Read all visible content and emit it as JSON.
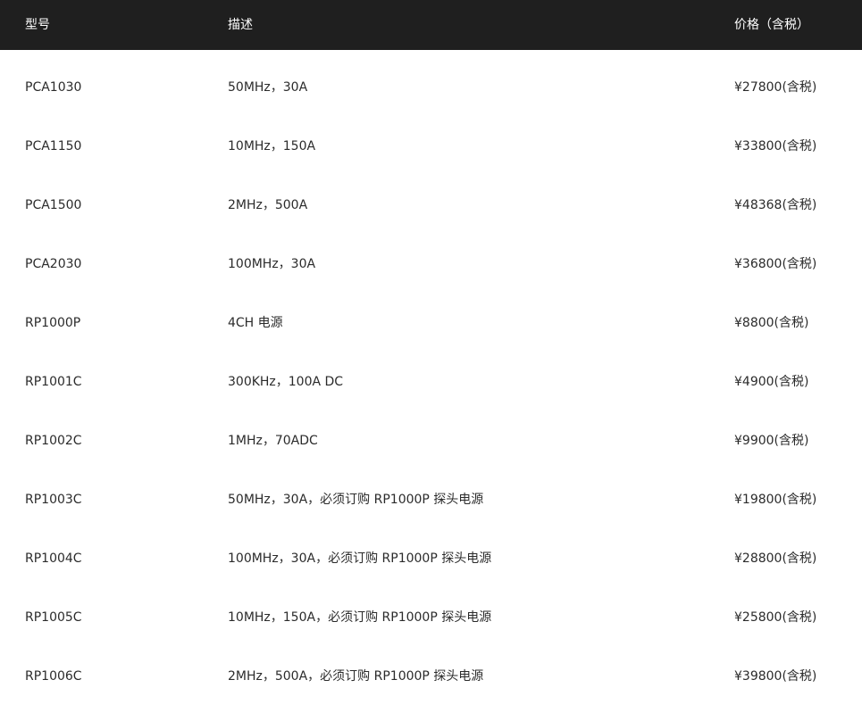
{
  "header": {
    "model": "型号",
    "description": "描述",
    "price": "价格（含税）"
  },
  "rows": [
    {
      "model": "PCA1030",
      "description": "50MHz，30A",
      "price": "¥27800(含税)"
    },
    {
      "model": "PCA1150",
      "description": "10MHz，150A",
      "price": "¥33800(含税)"
    },
    {
      "model": "PCA1500",
      "description": "2MHz，500A",
      "price": "¥48368(含税)"
    },
    {
      "model": "PCA2030",
      "description": "100MHz，30A",
      "price": "¥36800(含税)"
    },
    {
      "model": "RP1000P",
      "description": "4CH 电源",
      "price": "¥8800(含税)"
    },
    {
      "model": "RP1001C",
      "description": "300KHz，100A DC",
      "price": "¥4900(含税)"
    },
    {
      "model": "RP1002C",
      "description": "1MHz，70ADC",
      "price": "¥9900(含税)"
    },
    {
      "model": "RP1003C",
      "description": "50MHz，30A，必须订购 RP1000P 探头电源",
      "price": "¥19800(含税)"
    },
    {
      "model": "RP1004C",
      "description": "100MHz，30A，必须订购 RP1000P 探头电源",
      "price": "¥28800(含税)"
    },
    {
      "model": "RP1005C",
      "description": "10MHz，150A，必须订购 RP1000P 探头电源",
      "price": "¥25800(含税)"
    },
    {
      "model": "RP1006C",
      "description": "2MHz，500A，必须订购 RP1000P 探头电源",
      "price": "¥39800(含税)"
    }
  ]
}
